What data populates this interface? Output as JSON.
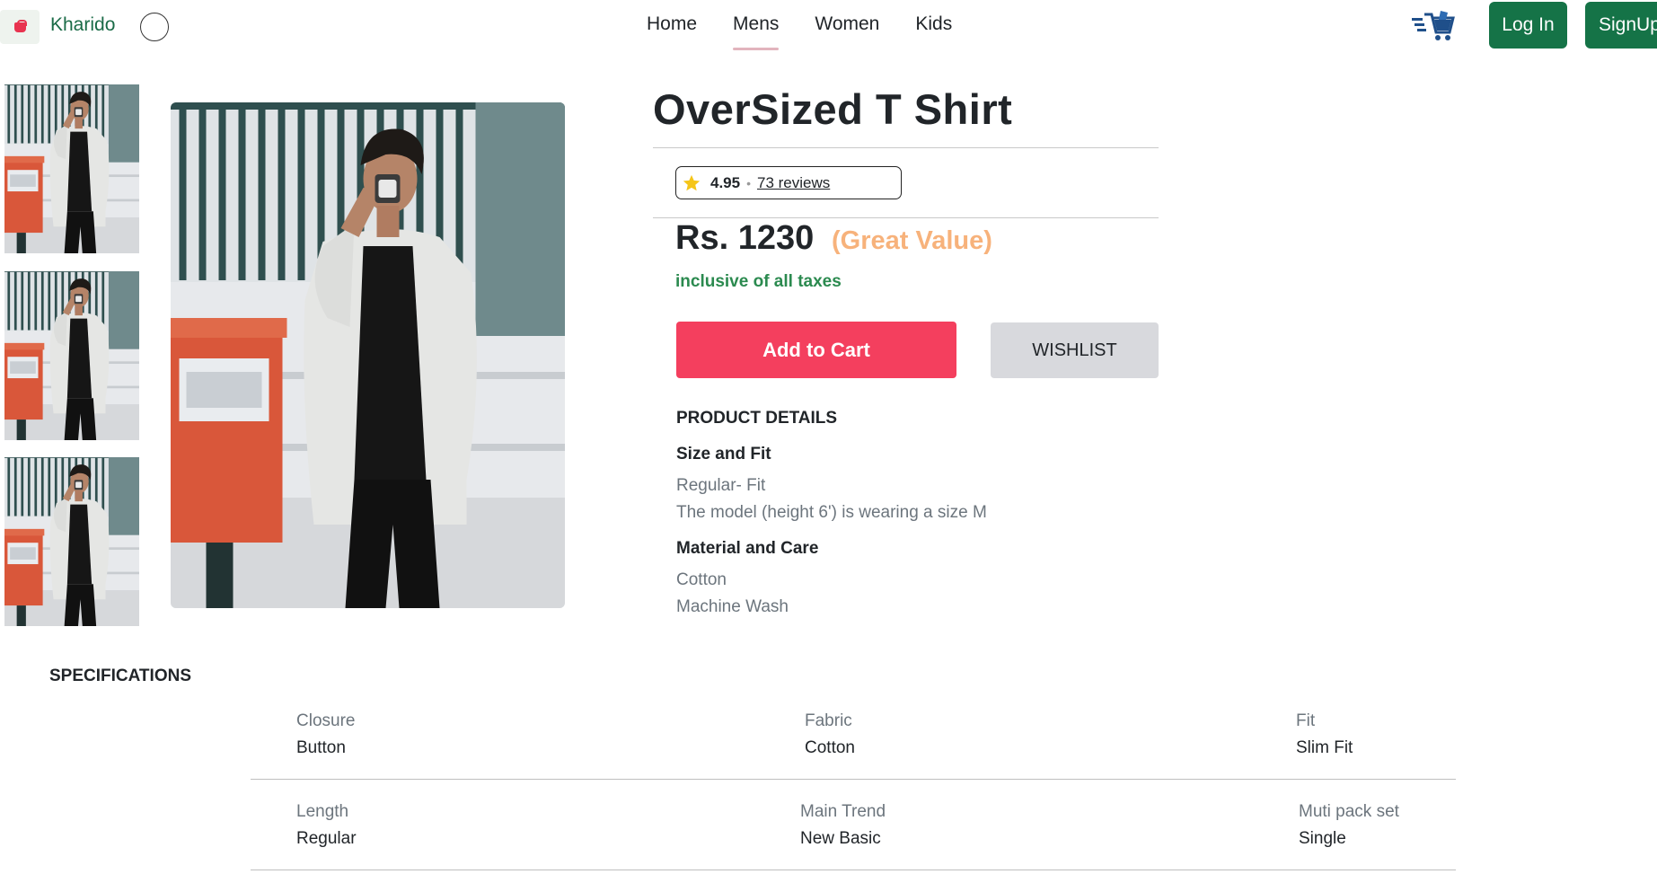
{
  "navbar": {
    "brand": "Kharido",
    "links": [
      {
        "label": "Home",
        "active": false
      },
      {
        "label": "Mens",
        "active": true
      },
      {
        "label": "Women",
        "active": false
      },
      {
        "label": "Kids",
        "active": false
      }
    ],
    "login_label": "Log In",
    "signup_label": "SignUp",
    "cart_icon": "shopping-cart-icon",
    "accent_color": "#157347"
  },
  "product": {
    "title": "OverSized T Shirt",
    "rating": "4.95",
    "separator": "•",
    "reviews": "73 reviews",
    "price": "Rs. 1230",
    "value_tag": "(Great Value)",
    "taxes_note": "inclusive of all taxes",
    "add_to_cart_label": "Add to Cart",
    "wishlist_label": "WISHLIST",
    "details": {
      "heading": "PRODUCT DETAILS",
      "size_fit_heading": "Size and Fit",
      "size_fit_lines": [
        "Regular- Fit",
        "The model (height 6') is wearing a size M"
      ],
      "material_heading": "Material and Care",
      "material_lines": [
        "Cotton",
        "Machine Wash"
      ]
    }
  },
  "specifications": {
    "heading": "SPECIFICATIONS",
    "rows": [
      [
        {
          "label": "Closure",
          "value": "Button"
        },
        {
          "label": "Fabric",
          "value": "Cotton"
        },
        {
          "label": "Fit",
          "value": "Slim Fit"
        }
      ],
      [
        {
          "label": "Length",
          "value": "Regular"
        },
        {
          "label": "Main Trend",
          "value": "New Basic"
        },
        {
          "label": "Muti pack set",
          "value": "Single"
        }
      ]
    ]
  },
  "colors": {
    "cart_button": "#f43f5e",
    "wishlist_button": "#d8d9dd",
    "great_value": "#f7b27b",
    "taxes_note": "#2b8a4f",
    "rating_star": "#f5c518"
  }
}
